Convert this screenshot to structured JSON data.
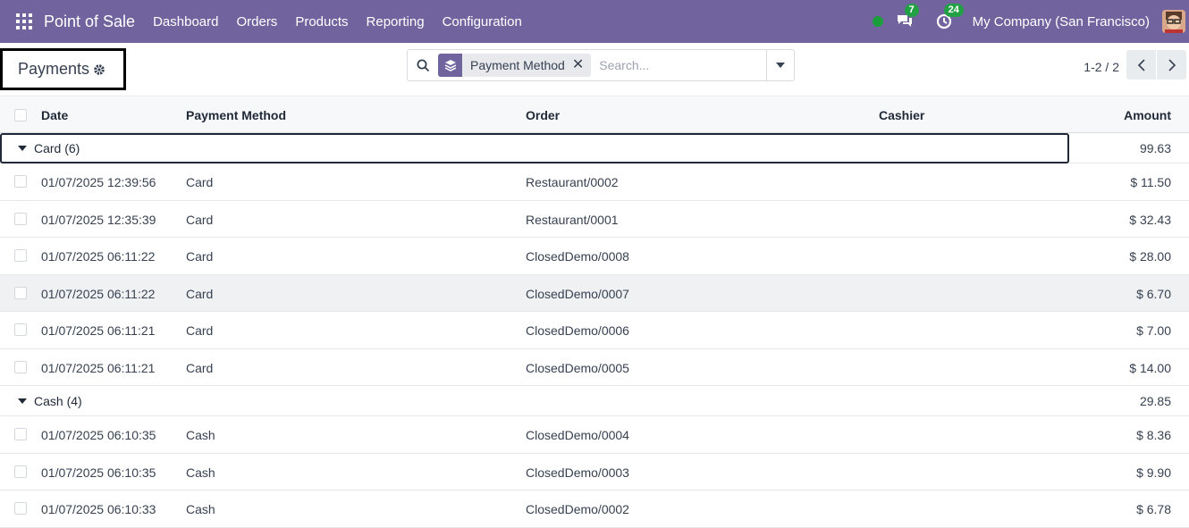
{
  "navbar": {
    "brand": "Point of Sale",
    "menu": [
      "Dashboard",
      "Orders",
      "Products",
      "Reporting",
      "Configuration"
    ],
    "messages_count": "7",
    "activities_count": "24",
    "company": "My Company (San Francisco)",
    "accent_color": "#71639e"
  },
  "control": {
    "title": "Payments",
    "facet_label": "Payment Method",
    "search_placeholder": "Search...",
    "pager": "1-2 / 2"
  },
  "table": {
    "headers": [
      "Date",
      "Payment Method",
      "Order",
      "Cashier",
      "Amount"
    ],
    "groups": [
      {
        "label": "Card (6)",
        "total": "99.63",
        "rows": [
          {
            "date": "01/07/2025 12:39:56",
            "method": "Card",
            "order": "Restaurant/0002",
            "cashier": "",
            "amount": "$ 11.50"
          },
          {
            "date": "01/07/2025 12:35:39",
            "method": "Card",
            "order": "Restaurant/0001",
            "cashier": "",
            "amount": "$ 32.43"
          },
          {
            "date": "01/07/2025 06:11:22",
            "method": "Card",
            "order": "ClosedDemo/0008",
            "cashier": "",
            "amount": "$ 28.00"
          },
          {
            "date": "01/07/2025 06:11:22",
            "method": "Card",
            "order": "ClosedDemo/0007",
            "cashier": "",
            "amount": "$ 6.70"
          },
          {
            "date": "01/07/2025 06:11:21",
            "method": "Card",
            "order": "ClosedDemo/0006",
            "cashier": "",
            "amount": "$ 7.00"
          },
          {
            "date": "01/07/2025 06:11:21",
            "method": "Card",
            "order": "ClosedDemo/0005",
            "cashier": "",
            "amount": "$ 14.00"
          }
        ]
      },
      {
        "label": "Cash (4)",
        "total": "29.85",
        "rows": [
          {
            "date": "01/07/2025 06:10:35",
            "method": "Cash",
            "order": "ClosedDemo/0004",
            "cashier": "",
            "amount": "$ 8.36"
          },
          {
            "date": "01/07/2025 06:10:35",
            "method": "Cash",
            "order": "ClosedDemo/0003",
            "cashier": "",
            "amount": "$ 9.90"
          },
          {
            "date": "01/07/2025 06:10:33",
            "method": "Cash",
            "order": "ClosedDemo/0002",
            "cashier": "",
            "amount": "$ 6.78"
          }
        ]
      }
    ]
  }
}
